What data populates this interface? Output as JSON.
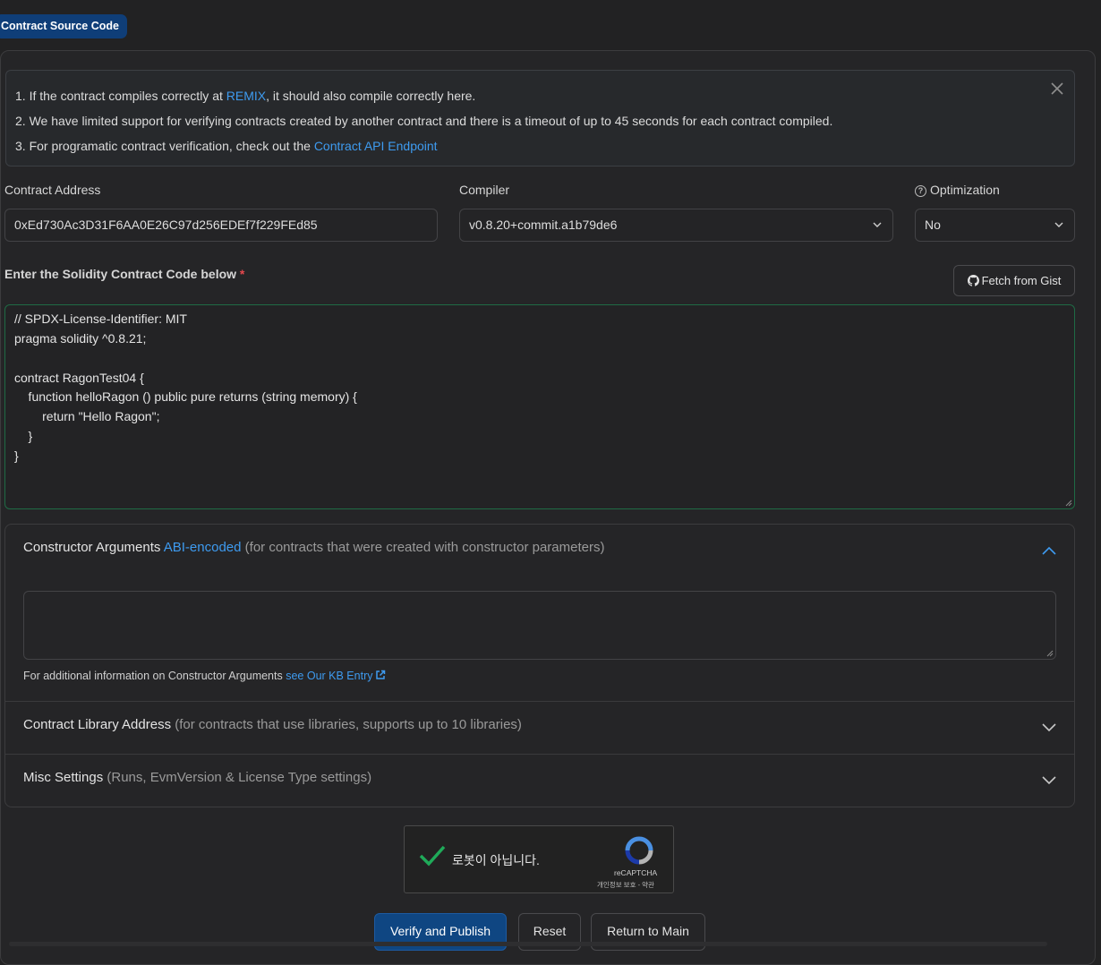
{
  "tab": {
    "label": "Contract Source Code"
  },
  "alert": {
    "line1_pre": "1. If the contract compiles correctly at ",
    "line1_link": "REMIX",
    "line1_post": ", it should also compile correctly here.",
    "line2": "2. We have limited support for verifying contracts created by another contract and there is a timeout of up to 45 seconds for each contract compiled.",
    "line3_pre": "3. For programatic contract verification, check out the ",
    "line3_link": "Contract API Endpoint"
  },
  "form": {
    "address_label": "Contract Address",
    "address_value": "0xEd730Ac3D31F6AA0E26C97d256EDEf7f229FEd85",
    "compiler_label": "Compiler",
    "compiler_value": "v0.8.20+commit.a1b79de6",
    "optimization_label": "Optimization",
    "optimization_value": "No"
  },
  "code": {
    "label": "Enter the Solidity Contract Code below",
    "required_mark": "*",
    "fetch_button": "Fetch from Gist",
    "lines": [
      "// SPDX-License-Identifier: MIT",
      "pragma solidity ^0.8.21;",
      "",
      "contract RagonTest04 {",
      "    function helloRagon () public pure returns (string memory) {",
      "        return \"Hello Ragon\";",
      "    }",
      "}"
    ]
  },
  "accordion": {
    "ctor_title": "Constructor Arguments",
    "ctor_link": "ABI-encoded",
    "ctor_desc": "(for contracts that were created with constructor parameters)",
    "ctor_note": "For additional information on Constructor Arguments",
    "ctor_note_link": "see Our KB Entry",
    "lib_title": "Contract Library Address",
    "lib_desc": "(for contracts that use libraries, supports up to 10 libraries)",
    "misc_title": "Misc Settings",
    "misc_desc": "(Runs, EvmVersion & License Type settings)"
  },
  "captcha": {
    "text": "로봇이 아닙니다.",
    "brand": "reCAPTCHA",
    "terms": "개인정보 보호 - 약관"
  },
  "buttons": {
    "verify": "Verify and Publish",
    "reset": "Reset",
    "return": "Return to Main"
  },
  "colors": {
    "accent": "#0f4682",
    "link": "#3e9bf0",
    "required": "#e5484d",
    "check": "#1faa59"
  }
}
